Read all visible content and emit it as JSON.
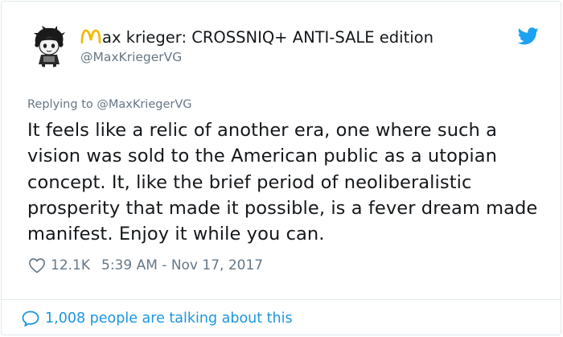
{
  "tweet": {
    "author": {
      "display_name": "ax krieger: CROSSNIQ+ ANTI-SALE edition",
      "handle": "@MaxKriegerVG"
    },
    "reply_prefix": "Replying to",
    "reply_to": "@MaxKriegerVG",
    "text": "It feels like a relic of another era, one where such a vision was sold to the American public as a utopian concept. It, like the brief period of neoliberalistic prosperity that made it possible, is a fever dream made manifest. Enjoy it while you can.",
    "likes": "12.1K",
    "timestamp": "5:39 AM - Nov 17, 2017",
    "talking_text": "1,008 people are talking about this"
  },
  "icons": {
    "logo": "mcdonalds-arches-icon",
    "platform": "twitter-bird-icon",
    "like": "heart-icon",
    "comments": "speech-bubble-icon"
  },
  "colors": {
    "link": "#1b95e0",
    "muted": "#657786",
    "text": "#14171a",
    "arches": "#f5b800"
  }
}
